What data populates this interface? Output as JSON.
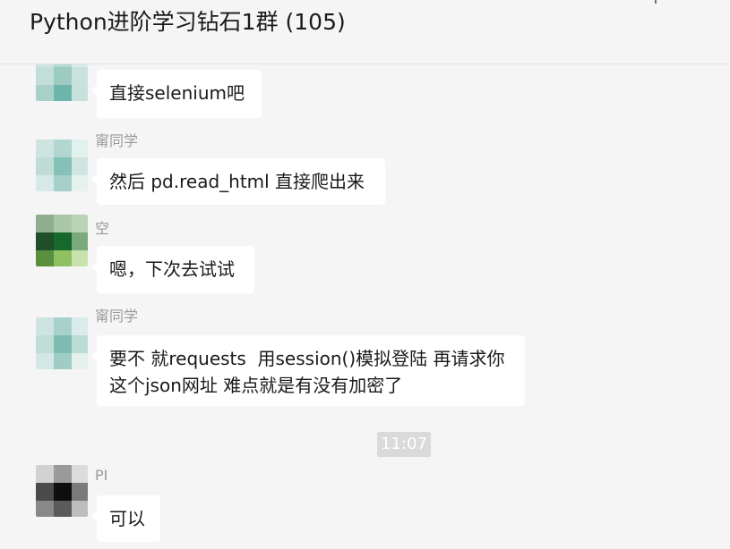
{
  "header": {
    "title": "Python进阶学习钻石1群 (105)",
    "more_label": "+"
  },
  "messages": [
    {
      "sender": "",
      "text": "直接selenium吧"
    },
    {
      "sender": "甯同学",
      "text": "然后 pd.read_html 直接爬出来"
    },
    {
      "sender": "空",
      "text": "嗯，下次去试试"
    },
    {
      "sender": "甯同学",
      "text": "要不 就requests  用session()模拟登陆 再请求你\n这个json网址 难点就是有没有加密了"
    },
    {
      "sender": "PI",
      "text": "可以"
    }
  ],
  "timestamp": "11:07"
}
